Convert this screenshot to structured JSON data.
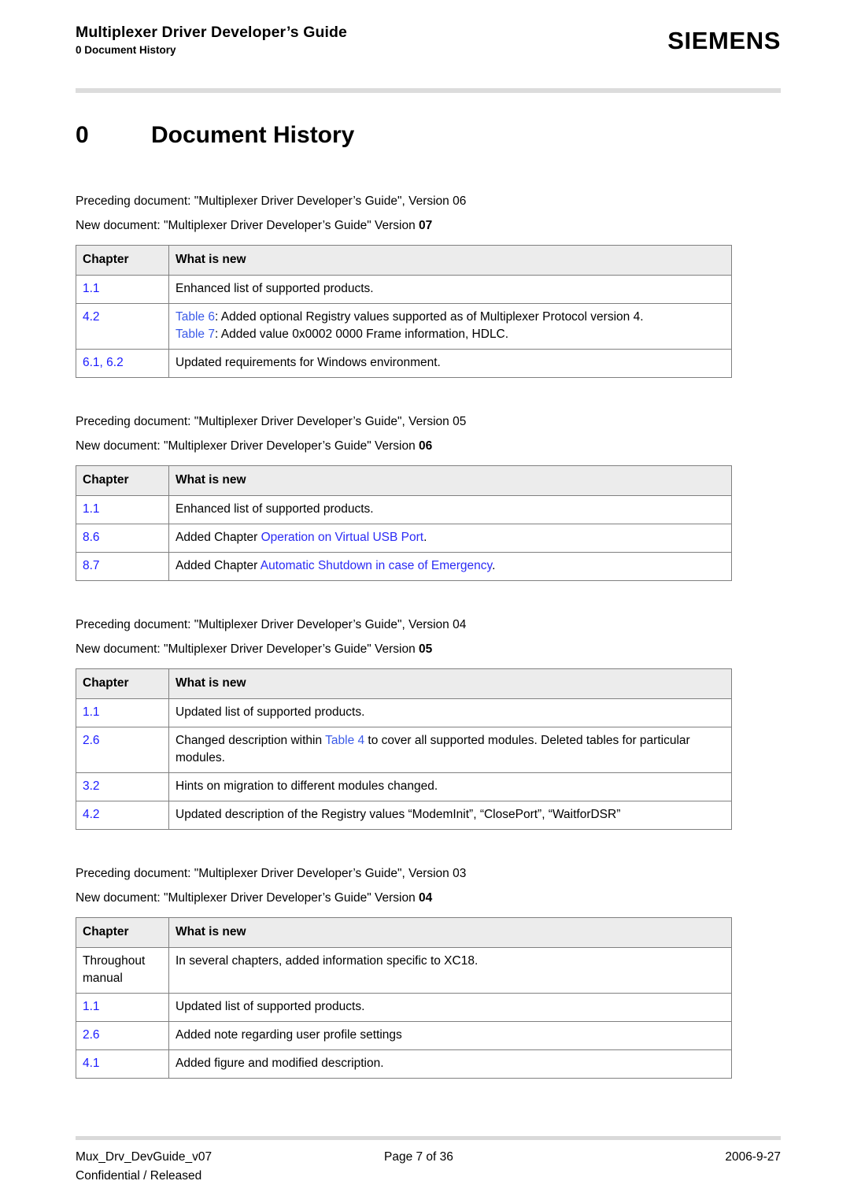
{
  "header": {
    "doc_title": "Multiplexer Driver Developer’s Guide",
    "doc_subtitle": "0 Document History",
    "brand": "SIEMENS"
  },
  "heading": {
    "number": "0",
    "title": "Document History"
  },
  "sections": [
    {
      "preceding": "Preceding document: \"Multiplexer Driver Developer’s Guide\", Version 06",
      "new_prefix": "New document: \"Multiplexer Driver Developer’s Guide\" Version ",
      "new_version": "07",
      "columns": [
        "Chapter",
        "What is new"
      ],
      "rows": [
        {
          "chapter": "1.1",
          "chapter_link": true,
          "what_parts": [
            {
              "text": "Enhanced list of supported products.",
              "style": "plain"
            }
          ]
        },
        {
          "chapter": "4.2",
          "chapter_link": true,
          "what_parts": [
            {
              "text": "Table 6",
              "style": "link-soft"
            },
            {
              "text": ": Added optional Registry values supported as of Multiplexer Protocol version 4.",
              "style": "plain"
            },
            {
              "text": "\n",
              "style": "break"
            },
            {
              "text": "Table 7",
              "style": "link-soft"
            },
            {
              "text": ": Added value 0x0002 0000 Frame information, HDLC.",
              "style": "plain"
            }
          ]
        },
        {
          "chapter": "6.1, 6.2",
          "chapter_link": true,
          "what_parts": [
            {
              "text": "Updated requirements for Windows environment.",
              "style": "plain"
            }
          ]
        }
      ]
    },
    {
      "preceding": "Preceding document: \"Multiplexer Driver Developer’s Guide\", Version 05",
      "new_prefix": "New document: \"Multiplexer Driver Developer’s Guide\" Version ",
      "new_version": "06",
      "columns": [
        "Chapter",
        "What is new"
      ],
      "rows": [
        {
          "chapter": "1.1",
          "chapter_link": true,
          "what_parts": [
            {
              "text": "Enhanced list of supported products.",
              "style": "plain"
            }
          ]
        },
        {
          "chapter": "8.6",
          "chapter_link": true,
          "what_parts": [
            {
              "text": "Added Chapter ",
              "style": "plain"
            },
            {
              "text": "Operation on Virtual USB Port",
              "style": "link"
            },
            {
              "text": ".",
              "style": "plain"
            }
          ]
        },
        {
          "chapter": "8.7",
          "chapter_link": true,
          "what_parts": [
            {
              "text": "Added Chapter ",
              "style": "plain"
            },
            {
              "text": "Automatic Shutdown in case of Emergency",
              "style": "link"
            },
            {
              "text": ".",
              "style": "plain"
            }
          ]
        }
      ]
    },
    {
      "preceding": "Preceding document: \"Multiplexer Driver Developer’s Guide\", Version 04",
      "new_prefix": "New document: \"Multiplexer Driver Developer’s Guide\" Version ",
      "new_version": "05",
      "columns": [
        "Chapter",
        "What is new"
      ],
      "rows": [
        {
          "chapter": "1.1",
          "chapter_link": true,
          "what_parts": [
            {
              "text": "Updated list of supported products.",
              "style": "plain"
            }
          ]
        },
        {
          "chapter": "2.6",
          "chapter_link": true,
          "what_parts": [
            {
              "text": "Changed description within ",
              "style": "plain"
            },
            {
              "text": "Table 4",
              "style": "link-soft"
            },
            {
              "text": " to cover all supported modules. Deleted tables for particular modules.",
              "style": "plain"
            }
          ]
        },
        {
          "chapter": "3.2",
          "chapter_link": true,
          "what_parts": [
            {
              "text": "Hints on migration to different modules changed.",
              "style": "plain"
            }
          ]
        },
        {
          "chapter": "4.2",
          "chapter_link": true,
          "what_parts": [
            {
              "text": "Updated description of the Registry values “ModemInit”, “ClosePort”, “WaitforDSR”",
              "style": "plain"
            }
          ]
        }
      ]
    },
    {
      "preceding": "Preceding document: \"Multiplexer Driver Developer’s Guide\", Version 03",
      "new_prefix": "New document: \"Multiplexer Driver Developer’s Guide\" Version ",
      "new_version": "04",
      "columns": [
        "Chapter",
        "What is new"
      ],
      "rows": [
        {
          "chapter": "Throughout manual",
          "chapter_link": false,
          "what_parts": [
            {
              "text": "In several chapters, added information specific to XC18.",
              "style": "plain"
            }
          ]
        },
        {
          "chapter": "1.1",
          "chapter_link": true,
          "what_parts": [
            {
              "text": "Updated list of supported products.",
              "style": "plain"
            }
          ]
        },
        {
          "chapter": "2.6",
          "chapter_link": true,
          "what_parts": [
            {
              "text": "Added note regarding user profile settings",
              "style": "plain"
            }
          ]
        },
        {
          "chapter": "4.1",
          "chapter_link": true,
          "what_parts": [
            {
              "text": "Added figure and modified description.",
              "style": "plain"
            }
          ]
        }
      ]
    }
  ],
  "footer": {
    "doc_id": "Mux_Drv_DevGuide_v07",
    "page": "Page 7 of 36",
    "date": "2006-9-27",
    "classification": "Confidential / Released"
  },
  "colors": {
    "link": "#2b2bf5",
    "link_soft": "#3b5be8",
    "chapter": "#1a1aff",
    "rule": "#dcdcdc",
    "table_header_bg": "#ececec",
    "table_border": "#808080"
  }
}
